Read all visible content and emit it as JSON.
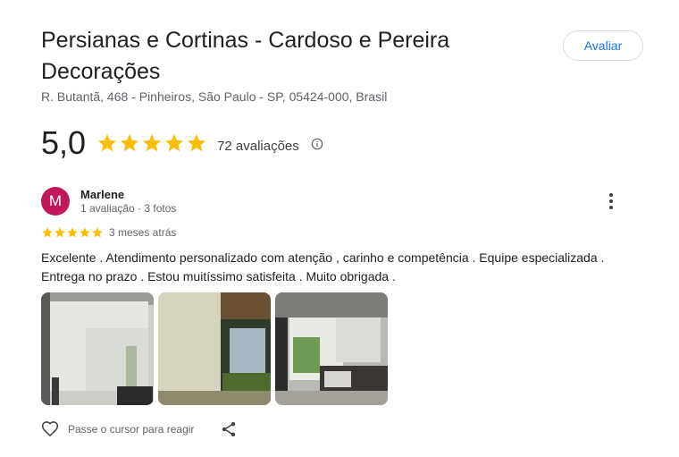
{
  "place": {
    "title": "Persianas e Cortinas - Cardoso e Pereira Decorações",
    "address": "R. Butantã, 468 - Pinheiros, São Paulo - SP, 05424-000, Brasil",
    "rate_button_label": "Avaliar"
  },
  "rating": {
    "value": "5,0",
    "stars": 5,
    "count_label": "72 avaliações",
    "star_color": "#fbbc04"
  },
  "review": {
    "avatar_letter": "M",
    "avatar_color": "#c2185b",
    "author": "Marlene",
    "meta": "1 avaliação · 3 fotos",
    "stars": 5,
    "date": "3 meses atrás",
    "text": "Excelente . Atendimento personalizado com atenção , carinho e competência . Equipe especializada . Entrega no prazo . Estou muitíssimo satisfeita . Muito obrigada .",
    "photo_count": 3,
    "react_label": "Passe o cursor para reagir"
  },
  "icons": {
    "star": "star-icon",
    "info": "info-icon",
    "more": "more-vert-icon",
    "heart": "heart-outline-icon",
    "share": "share-icon"
  }
}
